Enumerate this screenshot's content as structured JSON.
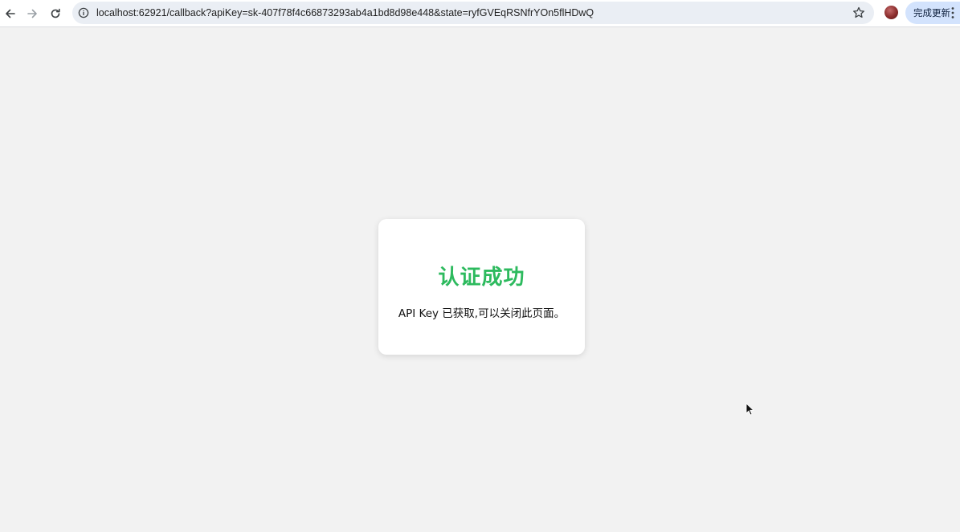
{
  "browser": {
    "url": "localhost:62921/callback?apiKey=sk-407f78f4c66873293ab4a1bd8d98e448&state=ryfGVEqRSNfrYOn5flHDwQ",
    "update_button_label": "完成更新",
    "icons": {
      "back": "back-arrow-icon",
      "forward": "forward-arrow-icon",
      "reload": "reload-icon",
      "site_info": "info-icon",
      "bookmark": "star-icon",
      "menu": "more-vert-icon"
    }
  },
  "card": {
    "title": "认证成功",
    "message": "API Key 已获取,可以关闭此页面。",
    "title_color": "#2dba5e"
  },
  "colors": {
    "page_background": "#f2f2f2",
    "omnibox_background": "#eaeef4",
    "update_button_background": "#d3e3fd"
  }
}
